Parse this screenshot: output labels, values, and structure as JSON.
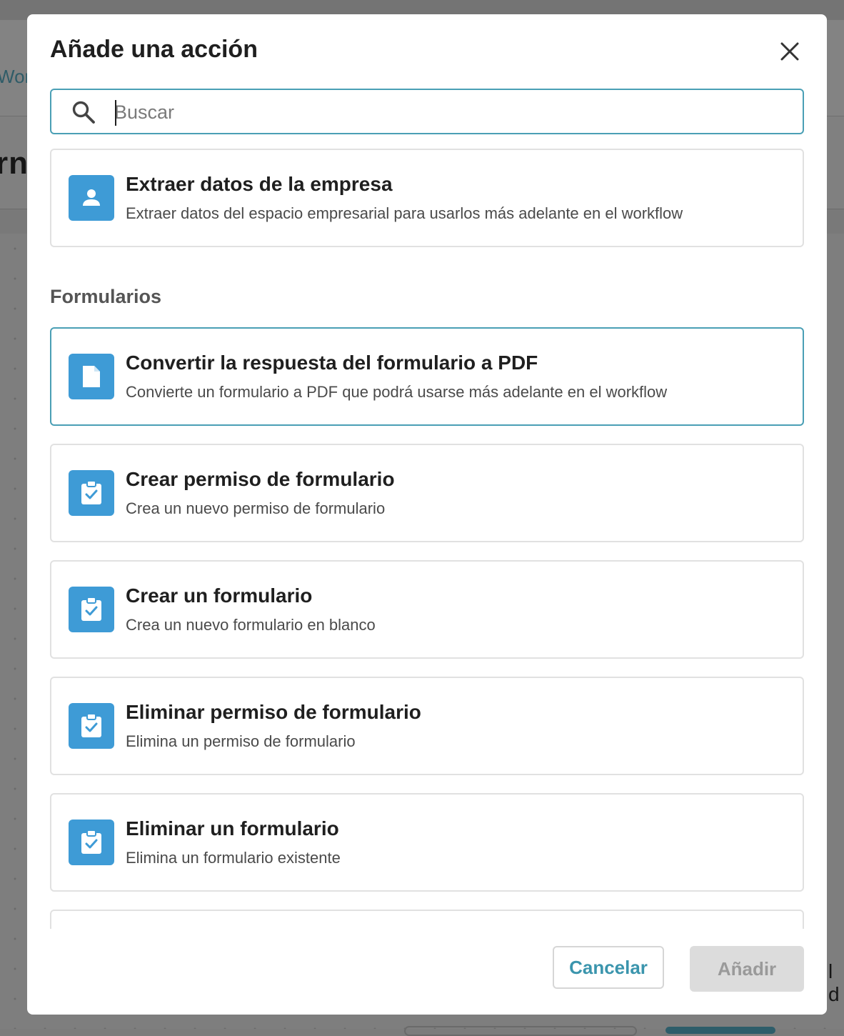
{
  "background": {
    "nav_fragment": "Wor",
    "title_fragment": "rn",
    "right_fragment": "l d"
  },
  "modal": {
    "title": "Añade una acción",
    "close_icon": "close-icon",
    "search": {
      "placeholder": "Buscar",
      "value": "",
      "icon": "search-icon"
    },
    "standalone_action": {
      "title": "Extraer datos de la empresa",
      "description": "Extraer datos del espacio empresarial para usarlos más adelante en el workflow",
      "icon": "user-icon"
    },
    "section": {
      "heading": "Formularios",
      "actions": [
        {
          "title": "Convertir la respuesta del formulario a PDF",
          "description": "Convierte un formulario a PDF que podrá usarse más adelante en el workflow",
          "icon": "document-icon",
          "selected": true
        },
        {
          "title": "Crear permiso de formulario",
          "description": "Crea un nuevo permiso de formulario",
          "icon": "clipboard-check-icon",
          "selected": false
        },
        {
          "title": "Crear un formulario",
          "description": "Crea un nuevo formulario en blanco",
          "icon": "clipboard-check-icon",
          "selected": false
        },
        {
          "title": "Eliminar permiso de formulario",
          "description": "Elimina un permiso de formulario",
          "icon": "clipboard-check-icon",
          "selected": false
        },
        {
          "title": "Eliminar un formulario",
          "description": "Elimina un formulario existente",
          "icon": "clipboard-check-icon",
          "selected": false
        }
      ]
    },
    "footer": {
      "cancel_label": "Cancelar",
      "add_label": "Añadir",
      "add_disabled": true
    }
  },
  "colors": {
    "accent": "#4a9fb5",
    "icon_tile": "#3e9bd6",
    "overlay": "#808080"
  }
}
